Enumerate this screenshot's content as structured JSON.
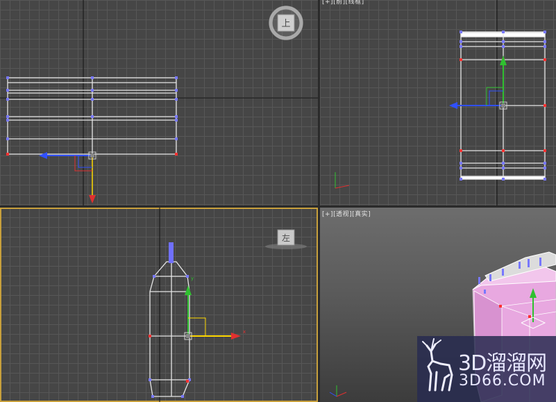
{
  "viewports": {
    "top": {
      "label": "",
      "viewcube_face": "上"
    },
    "front": {
      "label": "[+][前][线框]"
    },
    "left": {
      "label": "",
      "viewcube_face": "左",
      "axis_x": "x",
      "axis_y": "y"
    },
    "perspective": {
      "label": "[+][透视][真实]"
    }
  },
  "watermark": {
    "brand": "3D溜溜网",
    "domain": "3D66.COM"
  },
  "colors": {
    "viewport_bg": "#464646",
    "grid_line": "#575757",
    "active_border": "#c8a03c",
    "wire": "#ffffff",
    "vertex": "#7878ff",
    "selected_vertex": "#ff3030",
    "axis_x": "#e03030",
    "axis_y": "#30c030",
    "axis_z": "#3050ff",
    "gizmo_yellow": "#ffd800",
    "model_pink": "#e8a8e0"
  }
}
